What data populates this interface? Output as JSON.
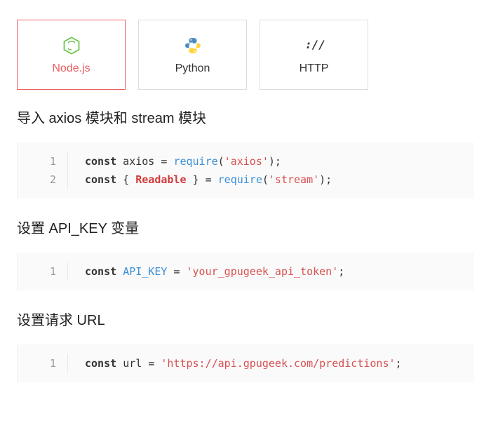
{
  "tabs": [
    {
      "label": "Node.js",
      "icon": "nodejs-icon",
      "active": true
    },
    {
      "label": "Python",
      "icon": "python-icon",
      "active": false
    },
    {
      "label": "HTTP",
      "icon": "http-icon",
      "active": false
    }
  ],
  "sections": [
    {
      "title": "导入 axios 模块和 stream 模块",
      "code": [
        {
          "n": "1",
          "tokens": [
            [
              "kw",
              "const"
            ],
            [
              "",
              ""
            ],
            [
              "var",
              " axios "
            ],
            [
              "op",
              "= "
            ],
            [
              "fn",
              "require"
            ],
            [
              "op",
              "("
            ],
            [
              "str",
              "'axios'"
            ],
            [
              "op",
              ");"
            ]
          ]
        },
        {
          "n": "2",
          "tokens": [
            [
              "kw",
              "const"
            ],
            [
              "",
              " { "
            ],
            [
              "cls",
              "Readable"
            ],
            [
              "",
              " } "
            ],
            [
              "op",
              "= "
            ],
            [
              "fn",
              "require"
            ],
            [
              "op",
              "("
            ],
            [
              "str",
              "'stream'"
            ],
            [
              "op",
              ");"
            ]
          ]
        }
      ]
    },
    {
      "title": "设置 API_KEY 变量",
      "code": [
        {
          "n": "1",
          "tokens": [
            [
              "kw",
              "const"
            ],
            [
              "",
              " "
            ],
            [
              "const-name",
              "API_KEY"
            ],
            [
              "",
              " "
            ],
            [
              "op",
              "= "
            ],
            [
              "str",
              "'your_gpugeek_api_token'"
            ],
            [
              "op",
              ";"
            ]
          ]
        }
      ]
    },
    {
      "title": "设置请求 URL",
      "code": [
        {
          "n": "1",
          "tokens": [
            [
              "kw",
              "const"
            ],
            [
              "",
              " "
            ],
            [
              "var",
              "url"
            ],
            [
              "",
              " "
            ],
            [
              "op",
              "= "
            ],
            [
              "str",
              "'https://api.gpugeek.com/predictions'"
            ],
            [
              "op",
              ";"
            ]
          ]
        }
      ]
    }
  ]
}
